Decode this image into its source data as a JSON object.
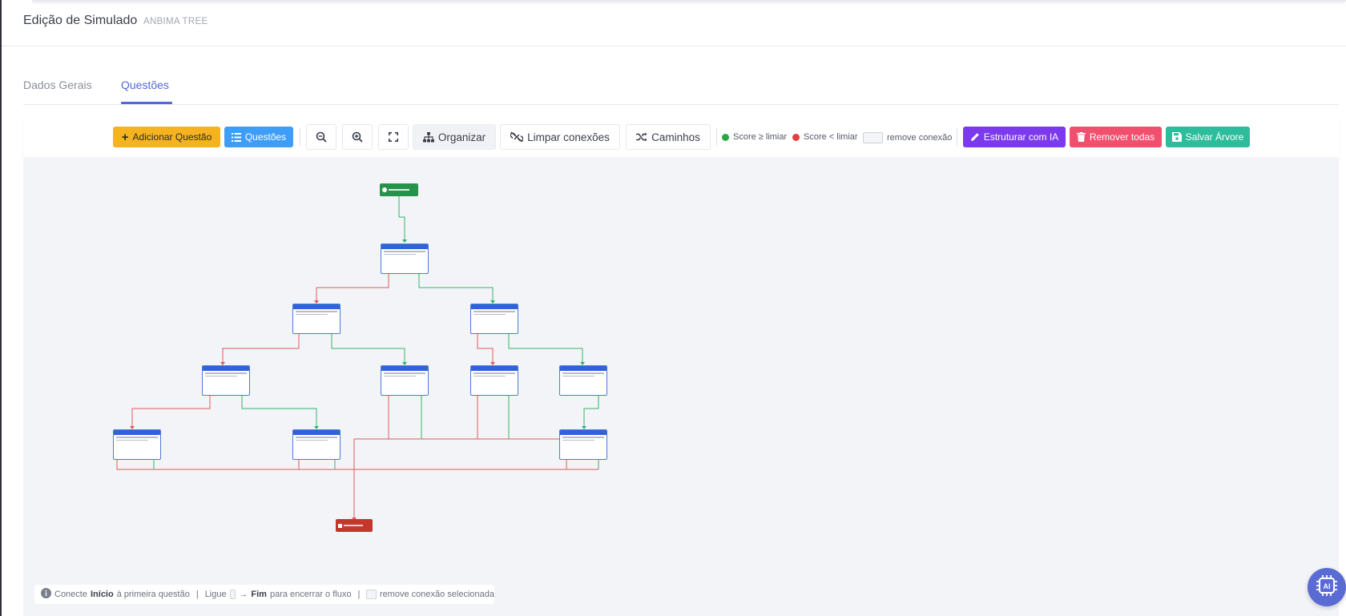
{
  "header": {
    "title": "Edição de Simulado",
    "subtitle": "ANBIMA TREE"
  },
  "tabs": [
    {
      "label": "Dados Gerais",
      "active": false
    },
    {
      "label": "Questões",
      "active": true
    }
  ],
  "toolbar": {
    "add_question": "Adicionar Questão",
    "questions": "Questões",
    "zoom_out_icon": "magnifier-minus-icon",
    "zoom_in_icon": "magnifier-plus-icon",
    "fit_icon": "expand-icon",
    "organize": "Organizar",
    "clear_connections": "Limpar conexões",
    "paths": "Caminhos",
    "legend_score_above": "Score ≥ limiar",
    "legend_score_below": "Score < limiar",
    "legend_remove": "remove conexão",
    "structure_ai": "Estruturar com IA",
    "remove_all": "Remover todas",
    "save_tree": "Salvar Árvore"
  },
  "colors": {
    "accent": "#5468d8",
    "add_question": "#f5b321",
    "questions": "#3e9ef7",
    "structure_ai": "#7c3aed",
    "remove_all": "#f0506e",
    "save_tree": "#2ebd9c",
    "score_above": "#28a745",
    "score_below": "#e53e3e",
    "node_header": "#2f63d6",
    "start_node": "#26934c",
    "end_node": "#c5362b",
    "edge_green": "#34b36a",
    "edge_red": "#e05a5a"
  },
  "canvas": {
    "hint": {
      "prefix": "Conecte",
      "start": "Início",
      "middle": "à primeira questão",
      "sep1": "|",
      "link": "Ligue",
      "arrow": "→",
      "end": "Fim",
      "end_text": "para encerrar o fluxo",
      "sep2": "|",
      "remove": "remove conexão selecionada"
    },
    "info_icon": "info-circle-icon"
  },
  "ai_fab": {
    "icon": "ai-chip-icon",
    "label": "AI"
  }
}
